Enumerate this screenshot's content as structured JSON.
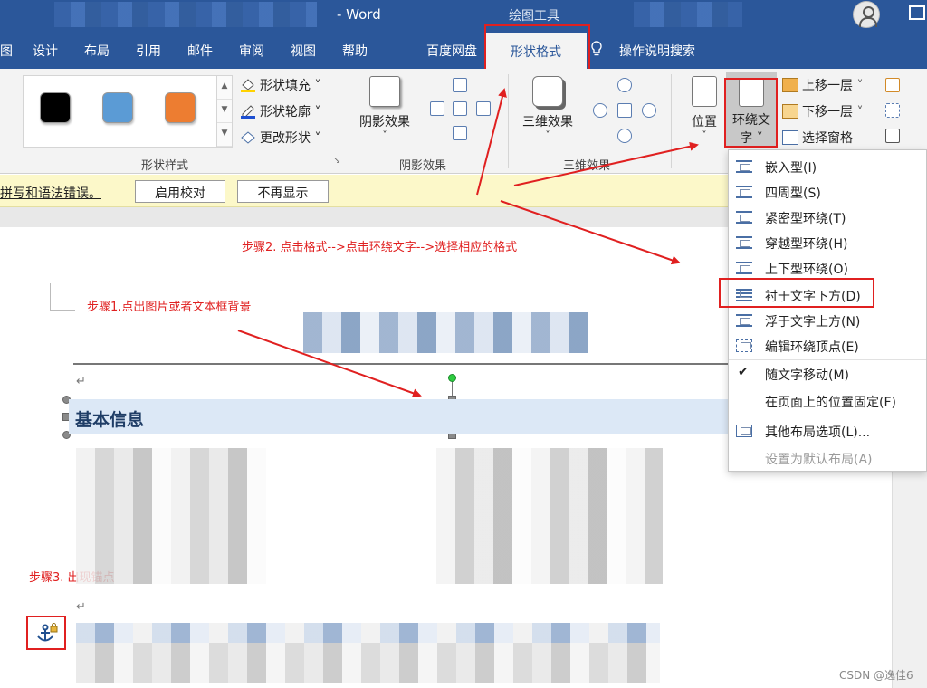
{
  "window": {
    "title": "- Word",
    "context_tab_group": "绘图工具"
  },
  "tabs": [
    {
      "label": "图"
    },
    {
      "label": "设计"
    },
    {
      "label": "布局"
    },
    {
      "label": "引用"
    },
    {
      "label": "邮件"
    },
    {
      "label": "审阅"
    },
    {
      "label": "视图"
    },
    {
      "label": "帮助"
    },
    {
      "label": "百度网盘"
    },
    {
      "label": "形状格式"
    },
    {
      "label": "操作说明搜索"
    }
  ],
  "ribbon": {
    "shape_styles": {
      "group_label": "形状样式",
      "swatches": [
        "#000000",
        "#5b9bd5",
        "#ed7d31"
      ],
      "fill": "形状填充",
      "outline": "形状轮廓",
      "change": "更改形状"
    },
    "shadow": {
      "button": "阴影效果",
      "group_label": "阴影效果"
    },
    "three_d": {
      "button": "三维效果",
      "group_label": "三维效果"
    },
    "arrange": {
      "position": "位置",
      "wrap_line1": "环绕文",
      "wrap_line2": "字",
      "bring_forward": "上移一层",
      "send_backward": "下移一层",
      "selection_pane": "选择窗格"
    }
  },
  "infobar": {
    "message": "拼写和语法错误。",
    "enable_button": "启用校对",
    "dismiss_button": "不再显示"
  },
  "document": {
    "heading": "基本信息",
    "return_mark": "↵"
  },
  "annotations": {
    "step1": "步骤1.点出图片或者文本框背景",
    "step2": "步骤2.   点击格式-->点击环绕文字-->选择相应的格式",
    "step3": "步骤3. 出现锚点"
  },
  "wrap_menu": {
    "items": [
      {
        "label": "嵌入型(I)"
      },
      {
        "label": "四周型(S)"
      },
      {
        "label": "紧密型环绕(T)"
      },
      {
        "label": "穿越型环绕(H)"
      },
      {
        "label": "上下型环绕(O)"
      },
      {
        "label": "衬于文字下方(D)"
      },
      {
        "label": "浮于文字上方(N)"
      },
      {
        "label": "编辑环绕顶点(E)"
      },
      {
        "label": "随文字移动(M)"
      },
      {
        "label": "在页面上的位置固定(F)"
      },
      {
        "label": "其他布局选项(L)..."
      },
      {
        "label": "设置为默认布局(A)"
      }
    ]
  },
  "watermark": "CSDN @逸佳6",
  "colors": {
    "word_blue": "#2b579a",
    "annotation_red": "#e02020",
    "heading_bg": "#dce8f6"
  }
}
